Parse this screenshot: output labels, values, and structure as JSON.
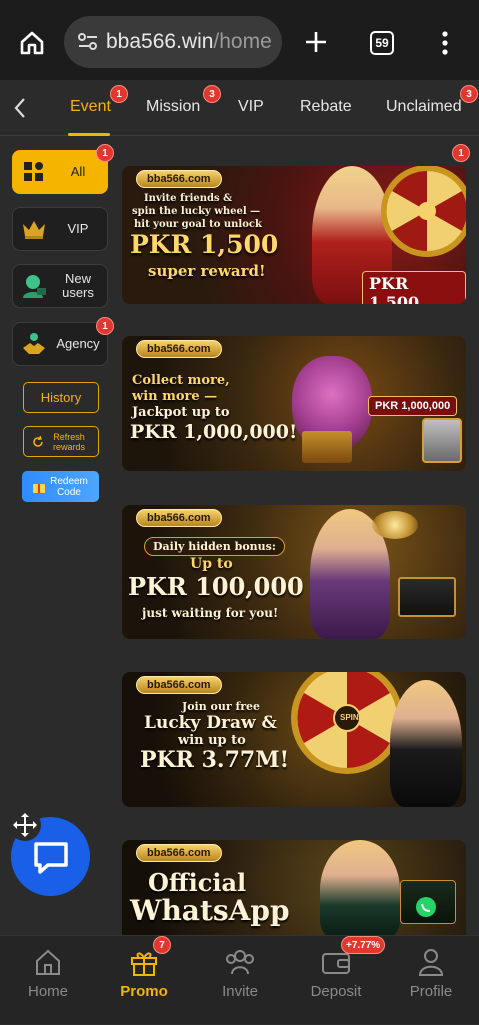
{
  "browser": {
    "url_host": "bba566.win",
    "url_rest": "/home",
    "tab_count": "59"
  },
  "tabs": [
    {
      "label": "Event",
      "badge": "1",
      "active": true
    },
    {
      "label": "Mission",
      "badge": "3"
    },
    {
      "label": "VIP",
      "badge": ""
    },
    {
      "label": "Rebate",
      "badge": ""
    },
    {
      "label": "Unclaimed",
      "badge": "3"
    }
  ],
  "sidebar": {
    "items": [
      {
        "label": "All",
        "badge": "1",
        "icon": "grid-icon",
        "active": true
      },
      {
        "label": "VIP",
        "badge": "",
        "icon": "crown-icon"
      },
      {
        "label": "New users",
        "badge": "",
        "icon": "new-user-icon"
      },
      {
        "label": "Agency",
        "badge": "1",
        "icon": "handshake-icon"
      }
    ],
    "history_label": "History",
    "refresh_label": "Refresh rewards",
    "redeem_label": "Redeem Code"
  },
  "banners": [
    {
      "logo": "bba566.com",
      "badge": "1",
      "line1": "Invite friends &",
      "line2": "spin the lucky wheel —",
      "line3": "hit your goal to unlock",
      "amount": "PKR 1,500",
      "tail": "super reward!",
      "chip": "PKR 1,500"
    },
    {
      "logo": "bba566.com",
      "line1": "Collect more,",
      "line2": "win more —",
      "line3": "Jackpot up to",
      "amount": "PKR 1,000,000!",
      "chip": "PKR 1,000,000"
    },
    {
      "logo": "bba566.com",
      "line1": "Daily hidden bonus:",
      "line2": "Up to",
      "amount": "PKR 100,000",
      "tail": "just waiting for you!"
    },
    {
      "logo": "bba566.com",
      "line1": "Join our free",
      "line2": "Lucky Draw &",
      "line3": "win up to",
      "amount": "PKR 3.77M!",
      "chip": "SPIN"
    },
    {
      "logo": "bba566.com",
      "line1": "Official",
      "line2": "WhatsApp"
    }
  ],
  "bottom_nav": [
    {
      "label": "Home",
      "icon": "home-icon",
      "badge": ""
    },
    {
      "label": "Promo",
      "icon": "gift-icon",
      "badge": "7",
      "active": true
    },
    {
      "label": "Invite",
      "icon": "invite-icon",
      "badge": ""
    },
    {
      "label": "Deposit",
      "icon": "wallet-icon",
      "badge": "+7.77%"
    },
    {
      "label": "Profile",
      "icon": "profile-icon",
      "badge": ""
    }
  ],
  "colors": {
    "accent": "#f5b400",
    "badge": "#e0372f",
    "fab": "#1a5fe8",
    "background": "#2b2b2b"
  }
}
